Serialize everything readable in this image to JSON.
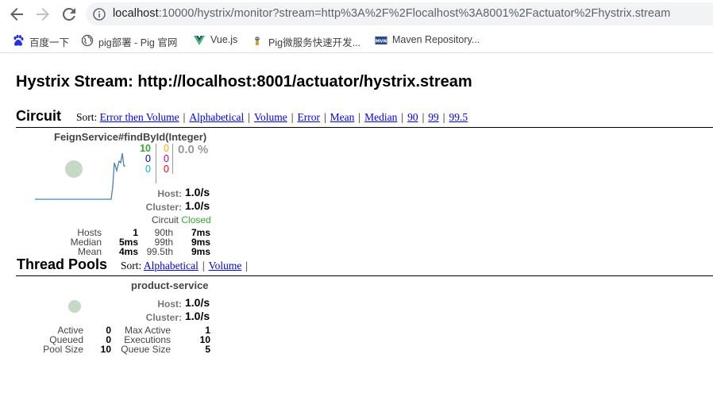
{
  "browser": {
    "url_host": "localhost",
    "url_rest": ":10000/hystrix/monitor?stream=http%3A%2F%2Flocalhost%3A8001%2Factuator%2Fhystrix.stream",
    "bookmarks": [
      {
        "label": "百度一下",
        "icon": "baidu-paw-icon"
      },
      {
        "label": "pig部署 - Pig 官网",
        "icon": "globe-icon"
      },
      {
        "label": "Vue.js",
        "icon": "vue-logo-icon"
      },
      {
        "label": "Pig微服务快速开发...",
        "icon": "pig-icon"
      },
      {
        "label": "Maven Repository...",
        "icon": "maven-icon"
      }
    ]
  },
  "page": {
    "title": "Hystrix Stream: http://localhost:8001/actuator/hystrix.stream"
  },
  "circuit_section": {
    "title": "Circuit",
    "sort_label": "Sort:",
    "sort_options": [
      "Error then Volume",
      "Alphabetical",
      "Volume",
      "Error",
      "Mean",
      "Median",
      "90",
      "99",
      "99.5"
    ]
  },
  "circuit": {
    "name": "FeignService#findById(Integer)",
    "success": "10",
    "short_circuited": "0",
    "bad_request": "0",
    "timeout": "0",
    "rejected": "0",
    "failure": "0",
    "error_pct": "0.0 %",
    "host_label": "Host:",
    "host_rate": "1.0/s",
    "cluster_label": "Cluster:",
    "cluster_rate": "1.0/s",
    "status_label": "Circuit",
    "status_value": "Closed",
    "stats": {
      "hosts_label": "Hosts",
      "hosts": "1",
      "median_label": "Median",
      "median": "5ms",
      "mean_label": "Mean",
      "mean": "4ms",
      "p90_label": "90th",
      "p90": "7ms",
      "p99_label": "99th",
      "p99": "9ms",
      "p995_label": "99.5th",
      "p995": "9ms"
    },
    "colors": {
      "success": "#33aa33",
      "short": "#0000cc",
      "bad": "#00bbbb",
      "timeout": "#ffaa00",
      "rejected": "#aa00aa",
      "failure": "#ff0000",
      "error_pct": "#999999",
      "bubble": "#c6d8c6",
      "sparkline": "#4682b4"
    }
  },
  "threadpool_section": {
    "title": "Thread Pools",
    "sort_label": "Sort:",
    "sort_options": [
      "Alphabetical",
      "Volume"
    ]
  },
  "threadpool": {
    "name": "product-service",
    "host_label": "Host:",
    "host_rate": "1.0/s",
    "cluster_label": "Cluster:",
    "cluster_rate": "1.0/s",
    "stats": {
      "active_label": "Active",
      "active": "0",
      "queued_label": "Queued",
      "queued": "0",
      "pool_size_label": "Pool Size",
      "pool_size": "10",
      "max_active_label": "Max Active",
      "max_active": "1",
      "executions_label": "Executions",
      "executions": "10",
      "queue_size_label": "Queue Size",
      "queue_size": "5"
    }
  }
}
